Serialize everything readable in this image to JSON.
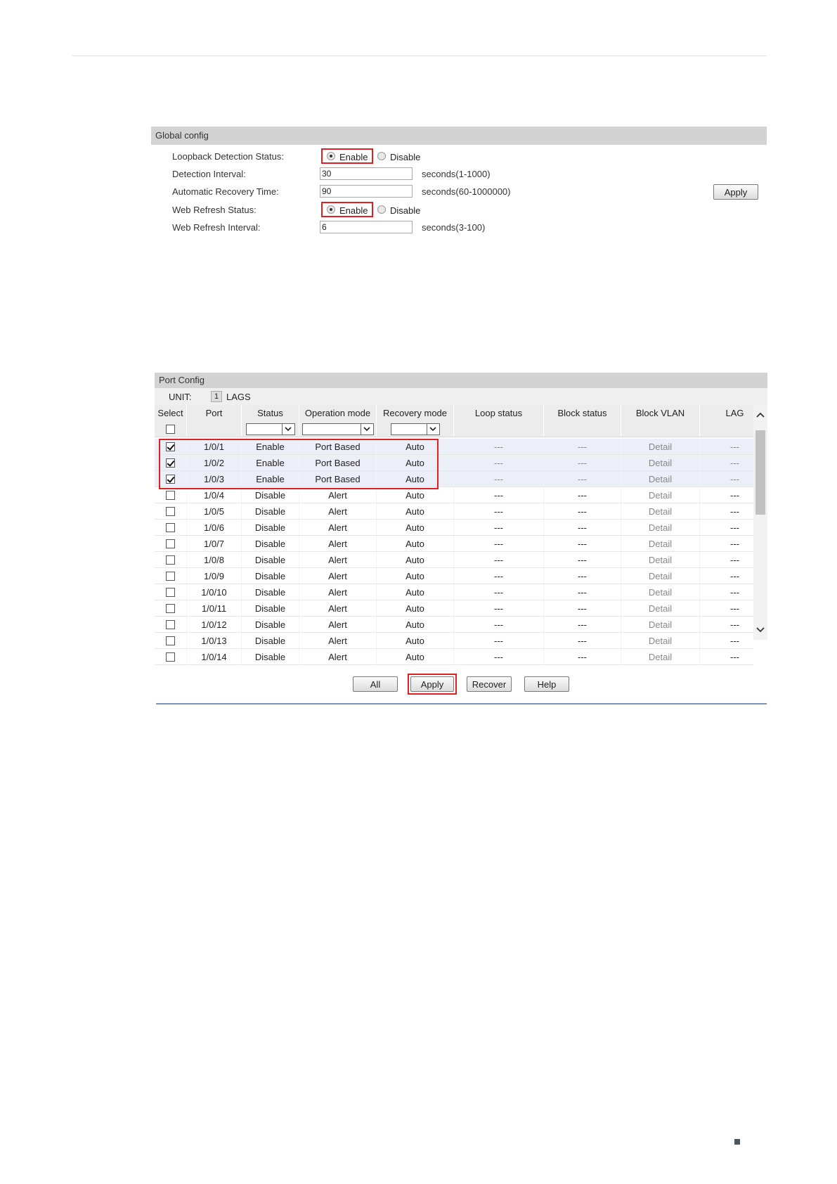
{
  "global_config": {
    "title": "Global config",
    "loopback_label": "Loopback Detection Status:",
    "enable_label": "Enable",
    "disable_label": "Disable",
    "loopback_status": "Enable",
    "detection_interval_label": "Detection Interval:",
    "detection_interval_value": "30",
    "detection_interval_hint": "seconds(1-1000)",
    "recovery_time_label": "Automatic Recovery Time:",
    "recovery_time_value": "90",
    "recovery_time_hint": "seconds(60-1000000)",
    "web_refresh_label": "Web Refresh Status:",
    "web_refresh_status": "Enable",
    "web_refresh_interval_label": "Web Refresh Interval:",
    "web_refresh_interval_value": "6",
    "web_refresh_interval_hint": "seconds(3-100)",
    "apply_label": "Apply"
  },
  "port_config": {
    "title": "Port Config",
    "unit_label": "UNIT:",
    "unit_value": "1",
    "lags_label": "LAGS",
    "columns": [
      "Select",
      "Port",
      "Status",
      "Operation mode",
      "Recovery mode",
      "Loop status",
      "Block status",
      "Block VLAN",
      "LAG"
    ],
    "rows": [
      {
        "checked": true,
        "port": "1/0/1",
        "status": "Enable",
        "operation": "Port Based",
        "recovery": "Auto",
        "loop": "---",
        "block": "---",
        "vlan": "Detail",
        "lag": "---"
      },
      {
        "checked": true,
        "port": "1/0/2",
        "status": "Enable",
        "operation": "Port Based",
        "recovery": "Auto",
        "loop": "---",
        "block": "---",
        "vlan": "Detail",
        "lag": "---"
      },
      {
        "checked": true,
        "port": "1/0/3",
        "status": "Enable",
        "operation": "Port Based",
        "recovery": "Auto",
        "loop": "---",
        "block": "---",
        "vlan": "Detail",
        "lag": "---"
      },
      {
        "checked": false,
        "port": "1/0/4",
        "status": "Disable",
        "operation": "Alert",
        "recovery": "Auto",
        "loop": "---",
        "block": "---",
        "vlan": "Detail",
        "lag": "---"
      },
      {
        "checked": false,
        "port": "1/0/5",
        "status": "Disable",
        "operation": "Alert",
        "recovery": "Auto",
        "loop": "---",
        "block": "---",
        "vlan": "Detail",
        "lag": "---"
      },
      {
        "checked": false,
        "port": "1/0/6",
        "status": "Disable",
        "operation": "Alert",
        "recovery": "Auto",
        "loop": "---",
        "block": "---",
        "vlan": "Detail",
        "lag": "---"
      },
      {
        "checked": false,
        "port": "1/0/7",
        "status": "Disable",
        "operation": "Alert",
        "recovery": "Auto",
        "loop": "---",
        "block": "---",
        "vlan": "Detail",
        "lag": "---"
      },
      {
        "checked": false,
        "port": "1/0/8",
        "status": "Disable",
        "operation": "Alert",
        "recovery": "Auto",
        "loop": "---",
        "block": "---",
        "vlan": "Detail",
        "lag": "---"
      },
      {
        "checked": false,
        "port": "1/0/9",
        "status": "Disable",
        "operation": "Alert",
        "recovery": "Auto",
        "loop": "---",
        "block": "---",
        "vlan": "Detail",
        "lag": "---"
      },
      {
        "checked": false,
        "port": "1/0/10",
        "status": "Disable",
        "operation": "Alert",
        "recovery": "Auto",
        "loop": "---",
        "block": "---",
        "vlan": "Detail",
        "lag": "---"
      },
      {
        "checked": false,
        "port": "1/0/11",
        "status": "Disable",
        "operation": "Alert",
        "recovery": "Auto",
        "loop": "---",
        "block": "---",
        "vlan": "Detail",
        "lag": "---"
      },
      {
        "checked": false,
        "port": "1/0/12",
        "status": "Disable",
        "operation": "Alert",
        "recovery": "Auto",
        "loop": "---",
        "block": "---",
        "vlan": "Detail",
        "lag": "---"
      },
      {
        "checked": false,
        "port": "1/0/13",
        "status": "Disable",
        "operation": "Alert",
        "recovery": "Auto",
        "loop": "---",
        "block": "---",
        "vlan": "Detail",
        "lag": "---"
      },
      {
        "checked": false,
        "port": "1/0/14",
        "status": "Disable",
        "operation": "Alert",
        "recovery": "Auto",
        "loop": "---",
        "block": "---",
        "vlan": "Detail",
        "lag": "---"
      }
    ],
    "buttons": {
      "all": "All",
      "apply": "Apply",
      "recover": "Recover",
      "help": "Help"
    }
  },
  "colors": {
    "highlight": "#e02020",
    "header_bg": "#d3d3d3",
    "selected_row": "#eceef8"
  }
}
